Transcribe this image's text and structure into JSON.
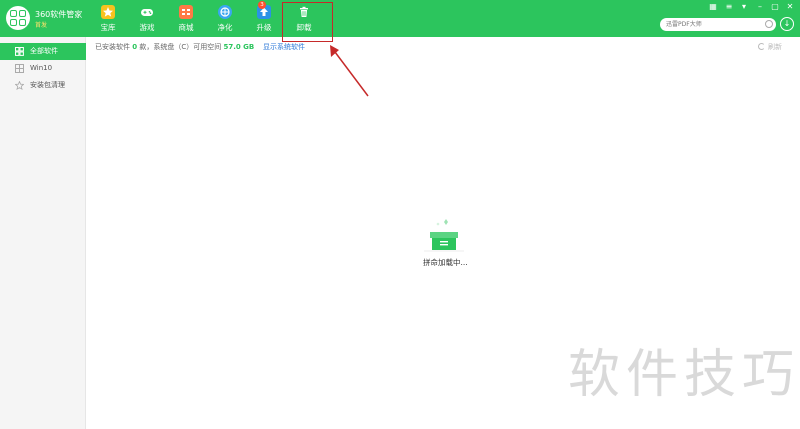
{
  "app": {
    "name": "360软件管家",
    "edition": "首发"
  },
  "toolbar": {
    "tabs": [
      {
        "label": "宝库",
        "icon": "star-icon",
        "color": "#f7c21e"
      },
      {
        "label": "游戏",
        "icon": "gamepad-icon",
        "color": "#ffffff"
      },
      {
        "label": "商城",
        "icon": "store-icon",
        "color": "#ff7a45"
      },
      {
        "label": "净化",
        "icon": "shield-icon",
        "color": "#3aa6f0"
      },
      {
        "label": "升级",
        "icon": "upgrade-arrow-icon",
        "color": "#2a92e6",
        "badge": "3"
      },
      {
        "label": "卸载",
        "icon": "trash-icon",
        "color": "#ffffff"
      }
    ],
    "active_tab": "卸载"
  },
  "window_controls": [
    "skin-icon",
    "menu-icon",
    "dropdown-icon",
    "minimize-icon",
    "maximize-icon",
    "close-icon"
  ],
  "search": {
    "placeholder": "迅雷PDF大师"
  },
  "sidebar": {
    "items": [
      {
        "label": "全部软件",
        "icon": "grid-icon",
        "active": true
      },
      {
        "label": "Win10",
        "icon": "windows-icon",
        "active": false
      },
      {
        "label": "安装包清理",
        "icon": "star-outline-icon",
        "active": false
      }
    ]
  },
  "infobar": {
    "prefix": "已安装软件",
    "count": "0",
    "middle": "款，系统盘（C）可用空间",
    "space": "57.0 GB",
    "system_link": "显示系统软件",
    "refresh": "刷新"
  },
  "status": {
    "loading_text": "拼命加载中..."
  },
  "watermark": {
    "text": "软件技巧"
  },
  "colors": {
    "brand": "#2cc55d",
    "annotation": "#c62a2a",
    "link": "#2f7ad8"
  }
}
